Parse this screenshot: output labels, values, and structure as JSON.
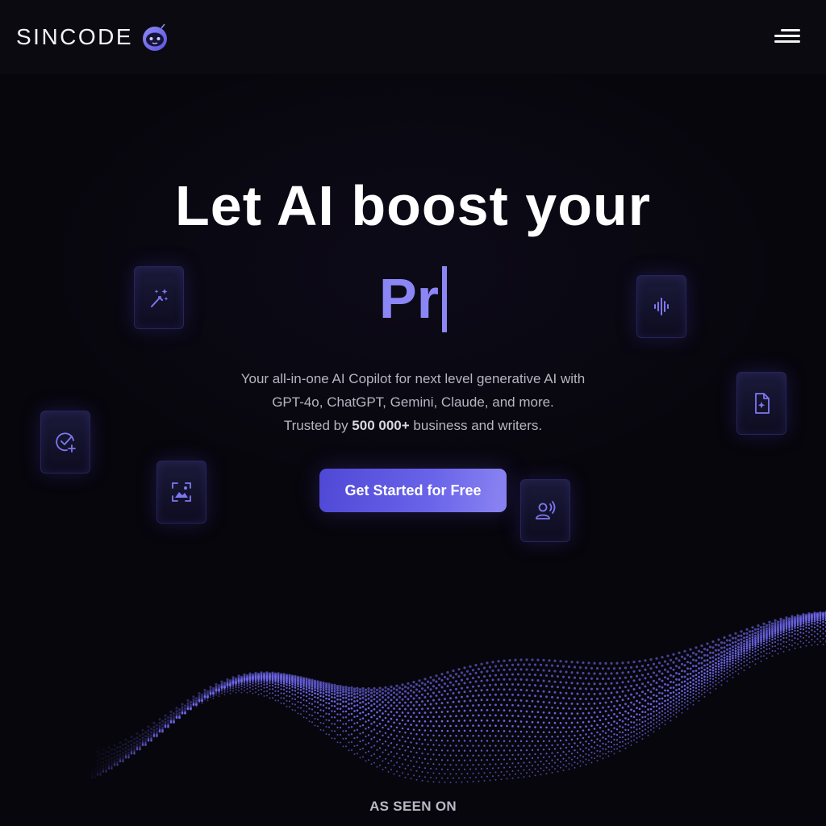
{
  "brand": {
    "name": "SINCODE",
    "mascot_icon": "robot-face-icon",
    "accent": "#8b86f5",
    "button_gradient": [
      "#4e48d6",
      "#8b85f2"
    ]
  },
  "header": {
    "menu_icon": "hamburger-menu-icon"
  },
  "hero": {
    "headline": "Let AI boost your",
    "typed_text": "Pr",
    "subtitle_line1": "Your all-in-one AI Copilot for next level generative AI with",
    "subtitle_line2": "GPT-4o, ChatGPT, Gemini, Claude, and more.",
    "subtitle_line3_prefix": "Trusted by ",
    "subtitle_line3_bold": "500 000+",
    "subtitle_line3_suffix": " business and writers.",
    "cta_label": "Get Started for Free"
  },
  "floating_cards": [
    {
      "icon": "magic-wand-icon"
    },
    {
      "icon": "sound-wave-icon"
    },
    {
      "icon": "document-sparkle-icon"
    },
    {
      "icon": "check-plus-icon"
    },
    {
      "icon": "image-scan-icon"
    },
    {
      "icon": "voice-person-icon"
    }
  ],
  "footer": {
    "as_seen_on": "AS SEEN ON"
  }
}
